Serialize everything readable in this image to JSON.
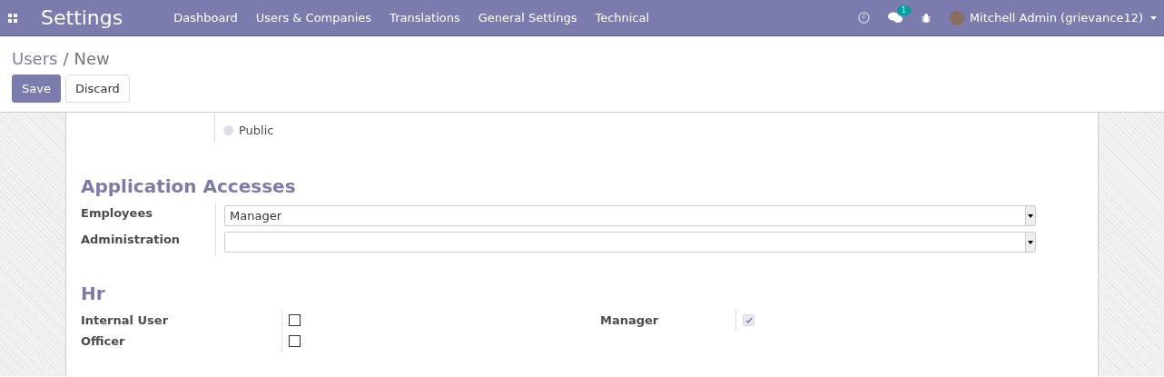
{
  "navbar": {
    "app_title": "Settings",
    "menu": [
      {
        "label": "Dashboard"
      },
      {
        "label": "Users & Companies"
      },
      {
        "label": "Translations"
      },
      {
        "label": "General Settings"
      },
      {
        "label": "Technical"
      }
    ],
    "messages_badge": "1",
    "user": "Mitchell Admin (grievance12)"
  },
  "breadcrumb": {
    "parent": "Users",
    "separator": "/",
    "current": "New"
  },
  "buttons": [
    {
      "label": "Save",
      "kind": "primary"
    },
    {
      "label": "Discard",
      "kind": "secondary"
    }
  ],
  "user_type": {
    "options": [
      {
        "label": "Public",
        "selected": false
      }
    ]
  },
  "application_accesses": {
    "title": "Application Accesses",
    "fields": [
      {
        "label": "Employees",
        "value": "Manager"
      },
      {
        "label": "Administration"
      }
    ]
  },
  "hr": {
    "title": "Hr",
    "left": [
      {
        "label": "Internal User",
        "checked": false,
        "disabled": false
      },
      {
        "label": "Officer",
        "checked": false,
        "disabled": false
      }
    ],
    "right": [
      {
        "label": "Manager",
        "checked": true,
        "disabled": true
      }
    ]
  }
}
